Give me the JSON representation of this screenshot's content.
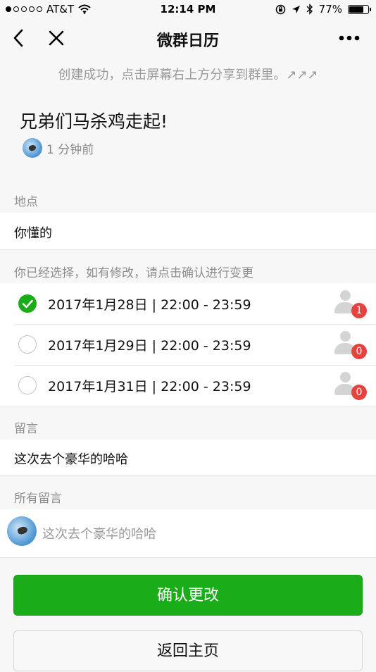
{
  "status_bar": {
    "carrier": "AT&T",
    "time": "12:14 PM",
    "battery": "77%",
    "battery_level": 0.77,
    "signal_bars": 1,
    "icons": [
      "wifi-icon",
      "lock-rotation-icon",
      "location-arrow-icon",
      "bluetooth-icon",
      "battery-icon"
    ]
  },
  "navbar": {
    "title": "微群日历",
    "icons": [
      "back-chevron-icon",
      "close-icon",
      "more-icon"
    ]
  },
  "hint": "创建成功，点击屏幕右上方分享到群里。↗↗↗",
  "event": {
    "title": "兄弟们马杀鸡走起!",
    "created_ago": "1 分钟前"
  },
  "location": {
    "label": "地点",
    "value": "你懂的"
  },
  "options": {
    "label": "你已经选择，如有修改，请点击确认进行变更",
    "items": [
      {
        "text": "2017年1月28日 | 22:00 - 23:59",
        "selected": true,
        "count": "1"
      },
      {
        "text": "2017年1月29日 | 22:00 - 23:59",
        "selected": false,
        "count": "0"
      },
      {
        "text": "2017年1月31日 | 22:00 - 23:59",
        "selected": false,
        "count": "0"
      }
    ]
  },
  "message": {
    "label": "留言",
    "value": "这次去个豪华的哈哈"
  },
  "all_messages": {
    "label": "所有留言",
    "items": [
      {
        "text": "这次去个豪华的哈哈"
      }
    ]
  },
  "buttons": {
    "confirm": "确认更改",
    "home": "返回主页"
  },
  "colors": {
    "primary_green": "#1aad19",
    "badge_red": "#e64340",
    "background": "#f7f7f7"
  }
}
